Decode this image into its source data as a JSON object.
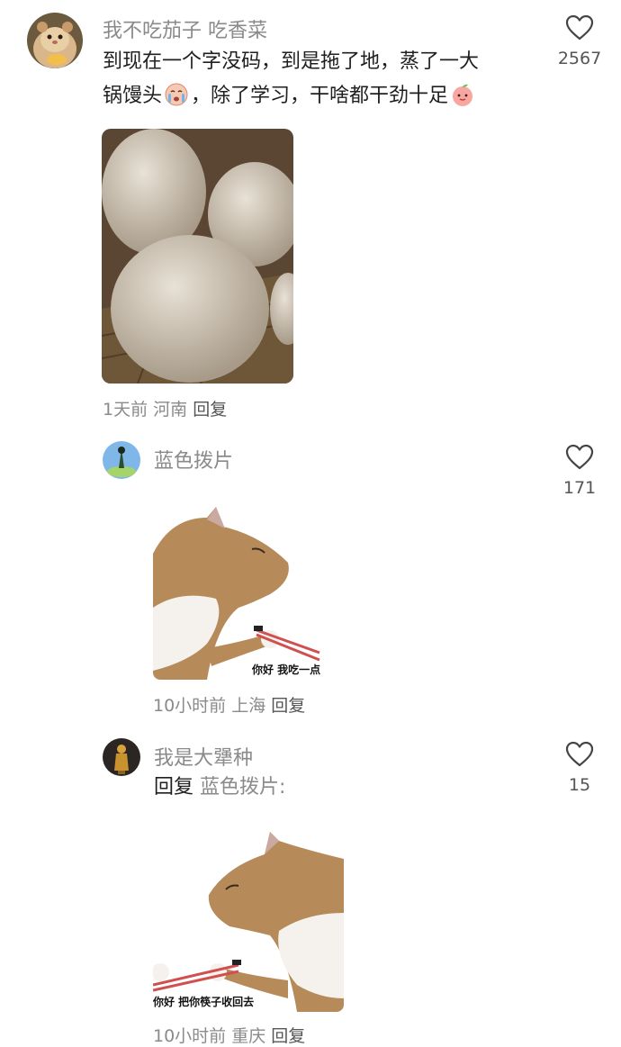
{
  "comments": [
    {
      "username": "我不吃茄子 吃香菜",
      "text_line1": "到现在一个字没码，到是拖了地，蒸了一大",
      "text_line2_a": "锅馒头",
      "text_line2_b": "，除了学习，干啥都干劲十足",
      "time": "1天前",
      "location": "河南",
      "reply": "回复",
      "likes": "2567"
    },
    {
      "username": "蓝色拨片",
      "time": "10小时前",
      "location": "上海",
      "reply": "回复",
      "likes": "171",
      "sticker_caption": "你好 我吃一点"
    },
    {
      "username": "我是大犟种",
      "reply_prefix": "回复",
      "reply_to": "蓝色拨片:",
      "time": "10小时前",
      "location": "重庆",
      "reply": "回复",
      "likes": "15",
      "sticker_caption": "你好 把你筷子收回去"
    }
  ],
  "icons": {
    "like": "heart-outline-icon",
    "emoji_1": "crying-face-emoji-icon",
    "emoji_2": "peach-face-emoji-icon"
  },
  "colors": {
    "username": "#8a8a8a",
    "text": "#1f1f1f",
    "meta": "#8a8a8a",
    "heart": "#444444"
  }
}
